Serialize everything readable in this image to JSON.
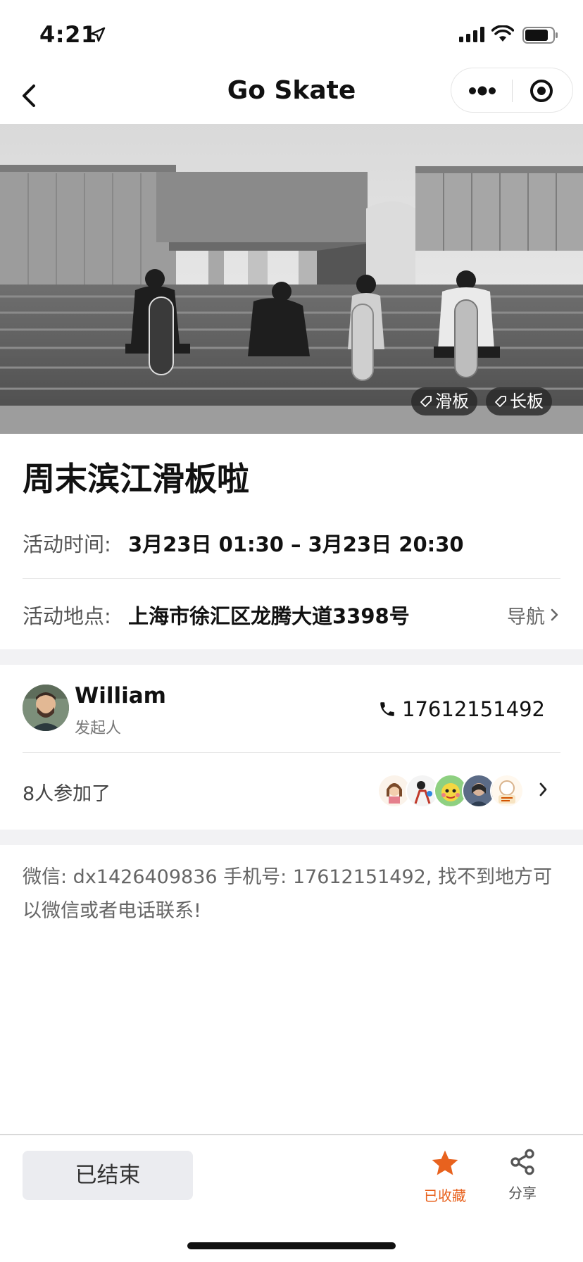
{
  "status_bar": {
    "time": "4:21"
  },
  "nav": {
    "title": "Go Skate"
  },
  "hero": {
    "tags": [
      "滑板",
      "长板"
    ]
  },
  "event": {
    "title": "周末滨江滑板啦",
    "time_label": "活动时间:",
    "time_value": "3月23日 01:30 – 3月23日 20:30",
    "place_label": "活动地点:",
    "place_value": "上海市徐汇区龙腾大道3398号",
    "navigate_label": "导航"
  },
  "organizer": {
    "name": "William",
    "role": "发起人",
    "phone": "17612151492"
  },
  "participants": {
    "count_text": "8人参加了"
  },
  "description": "微信: dx1426409836 手机号: 17612151492, 找不到地方可以微信或者电话联系!",
  "bottom_bar": {
    "ended_label": "已结束",
    "favorite_label": "已收藏",
    "share_label": "分享"
  },
  "colors": {
    "accent": "#e8621e",
    "background_gap": "#f2f2f4"
  }
}
